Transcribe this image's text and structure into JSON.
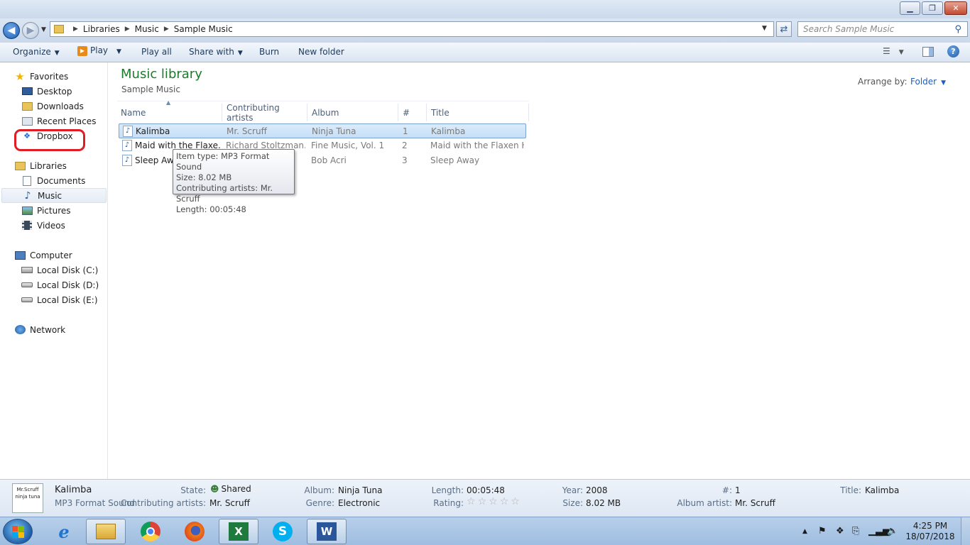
{
  "window": {
    "minimize": "▁",
    "restore": "❐",
    "close": "✕"
  },
  "address": {
    "crumbs": [
      "Libraries",
      "Music",
      "Sample Music"
    ],
    "search_placeholder": "Search Sample Music"
  },
  "toolbar": {
    "organize": "Organize",
    "play": "Play",
    "play_all": "Play all",
    "share_with": "Share with",
    "burn": "Burn",
    "new_folder": "New folder"
  },
  "nav": {
    "favorites": "Favorites",
    "desktop": "Desktop",
    "downloads": "Downloads",
    "recent_places": "Recent Places",
    "dropbox": "Dropbox",
    "libraries": "Libraries",
    "documents": "Documents",
    "music": "Music",
    "pictures": "Pictures",
    "videos": "Videos",
    "computer": "Computer",
    "disk_c": "Local Disk (C:)",
    "disk_d": "Local Disk (D:)",
    "disk_e": "Local Disk (E:)",
    "network": "Network"
  },
  "library": {
    "title": "Music library",
    "subtitle": "Sample Music",
    "arrange_label": "Arrange by:",
    "arrange_value": "Folder"
  },
  "columns": {
    "name": "Name",
    "artists": "Contributing artists",
    "album": "Album",
    "num": "#",
    "title": "Title"
  },
  "files": [
    {
      "name": "Kalimba",
      "artists": "Mr. Scruff",
      "album": "Ninja Tuna",
      "num": "1",
      "title": "Kalimba"
    },
    {
      "name": "Maid with the Flaxe...",
      "artists": "Richard Stoltzman...",
      "album": "Fine Music, Vol. 1",
      "num": "2",
      "title": "Maid with the Flaxen H..."
    },
    {
      "name": "Sleep Away",
      "artists": "",
      "album": "Bob Acri",
      "num": "3",
      "title": "Sleep Away"
    }
  ],
  "tooltip": {
    "line1": "Item type: MP3 Format Sound",
    "line2": "Size: 8.02 MB",
    "line3": "Contributing artists: Mr. Scruff",
    "line4": "Length: 00:05:48"
  },
  "details": {
    "art_text": "Mr.Scruff ninja tuna",
    "name": "Kalimba",
    "type": "MP3 Format Sound",
    "state_label": "State:",
    "state_value": "Shared",
    "artists_label": "Contributing artists:",
    "artists_value": "Mr. Scruff",
    "album_label": "Album:",
    "album_value": "Ninja Tuna",
    "genre_label": "Genre:",
    "genre_value": "Electronic",
    "length_label": "Length:",
    "length_value": "00:05:48",
    "rating_label": "Rating:",
    "year_label": "Year:",
    "year_value": "2008",
    "size_label": "Size:",
    "size_value": "8.02 MB",
    "num_label": "#:",
    "num_value": "1",
    "album_artist_label": "Album artist:",
    "album_artist_value": "Mr. Scruff",
    "title_label": "Title:",
    "title_value": "Kalimba"
  },
  "taskbar": {
    "time": "4:25 PM",
    "date": "18/07/2018",
    "apps": [
      "internet-explorer",
      "file-explorer",
      "chrome",
      "firefox",
      "excel",
      "skype",
      "word"
    ]
  },
  "colors": {
    "accent_green": "#1e7a2b",
    "link_blue": "#1e5ebc",
    "highlight_red": "#e01c24"
  }
}
